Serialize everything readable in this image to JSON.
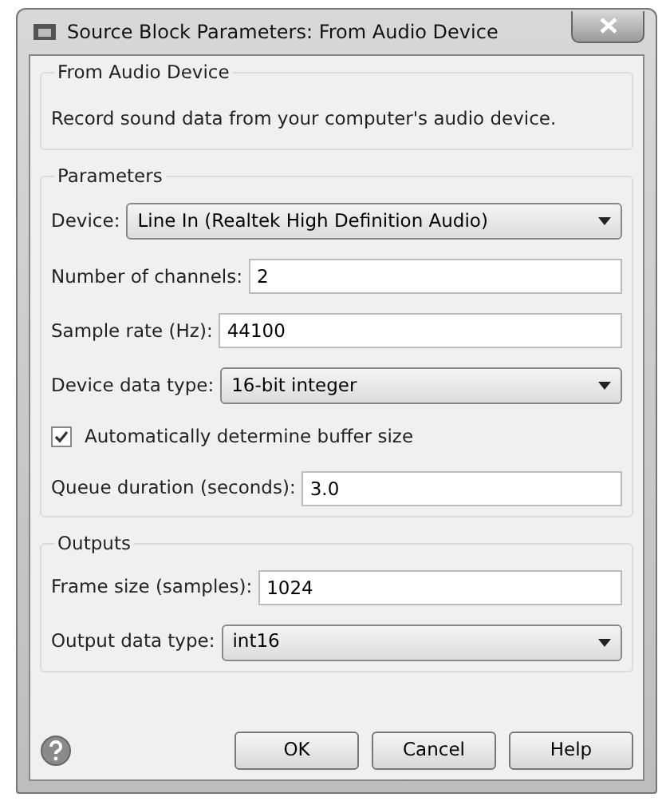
{
  "window": {
    "title": "Source Block Parameters: From Audio Device"
  },
  "groups": [
    {
      "title": "From Audio Device",
      "description": "Record sound data from your computer's audio device."
    },
    {
      "title": "Parameters",
      "fields": [
        {
          "kind": "dropdown",
          "label": "Device:",
          "value": "Line In (Realtek High Definition Audio)"
        },
        {
          "kind": "text",
          "label": "Number of channels:",
          "value": "2"
        },
        {
          "kind": "text",
          "label": "Sample rate (Hz):",
          "value": "44100"
        },
        {
          "kind": "dropdown",
          "label": "Device data type:",
          "value": "16-bit integer"
        },
        {
          "kind": "checkbox",
          "label": "Automatically determine buffer size",
          "checked": true
        },
        {
          "kind": "text",
          "label": "Queue duration (seconds):",
          "value": "3.0"
        }
      ]
    },
    {
      "title": "Outputs",
      "fields": [
        {
          "kind": "text",
          "label": "Frame size (samples):",
          "value": "1024"
        },
        {
          "kind": "dropdown",
          "label": "Output data type:",
          "value": "int16"
        }
      ]
    }
  ],
  "buttons": [
    "OK",
    "Cancel",
    "Help"
  ]
}
